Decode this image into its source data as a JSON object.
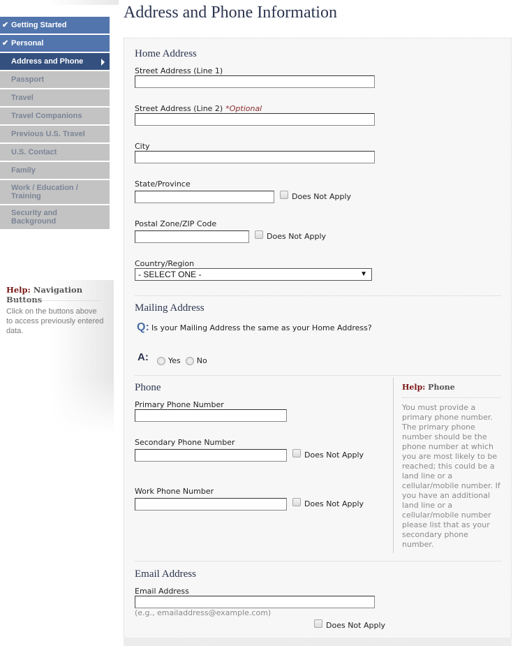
{
  "sidebar": {
    "items": [
      {
        "label": "Getting Started",
        "state": "completed",
        "icon": "check-icon"
      },
      {
        "label": "Personal",
        "state": "completed",
        "icon": "check-icon"
      },
      {
        "label": "Address and Phone",
        "state": "current",
        "icon": "arrow-right-icon"
      },
      {
        "label": "Passport",
        "state": "disabled"
      },
      {
        "label": "Travel",
        "state": "disabled"
      },
      {
        "label": "Travel Companions",
        "state": "disabled"
      },
      {
        "label": "Previous U.S. Travel",
        "state": "disabled"
      },
      {
        "label": "U.S. Contact",
        "state": "disabled"
      },
      {
        "label": "Family",
        "state": "disabled"
      },
      {
        "label": "Work / Education / Training",
        "state": "disabled"
      },
      {
        "label": "Security and Background",
        "state": "disabled"
      }
    ],
    "help": {
      "prefix": "Help:",
      "title": "Navigation Buttons",
      "text": "Click on the buttons above to access previously entered data."
    }
  },
  "page": {
    "title": "Address and Phone Information"
  },
  "home_address": {
    "title": "Home Address",
    "street1": {
      "label": "Street Address (Line 1)",
      "value": ""
    },
    "street2": {
      "label": "Street Address (Line 2)",
      "optional": "*Optional",
      "value": ""
    },
    "city": {
      "label": "City",
      "value": ""
    },
    "state": {
      "label": "State/Province",
      "value": "",
      "does_not_apply": "Does Not Apply"
    },
    "postal": {
      "label": "Postal Zone/ZIP Code",
      "value": "",
      "does_not_apply": "Does Not Apply"
    },
    "country": {
      "label": "Country/Region",
      "selected": "- SELECT ONE -"
    }
  },
  "mailing_address": {
    "title": "Mailing Address",
    "q_mark": "Q:",
    "question": "Is your Mailing Address the same as your Home Address?",
    "a_mark": "A:",
    "options": [
      "Yes",
      "No"
    ]
  },
  "phone": {
    "title": "Phone",
    "primary": {
      "label": "Primary Phone Number",
      "value": ""
    },
    "secondary": {
      "label": "Secondary Phone Number",
      "value": "",
      "does_not_apply": "Does Not Apply"
    },
    "work": {
      "label": "Work Phone Number",
      "value": "",
      "does_not_apply": "Does Not Apply"
    },
    "help": {
      "prefix": "Help:",
      "title": "Phone",
      "text": "You must provide a primary phone number. The primary phone number should be the phone number at which you are most likely to be reached; this could be a land line or a cellular/mobile number. If you have an additional land line or a cellular/mobile number please list that as your secondary phone number."
    }
  },
  "email": {
    "title": "Email Address",
    "label": "Email Address",
    "value": "",
    "hint": "(e.g., emailaddress@example.com)",
    "does_not_apply": "Does Not Apply"
  },
  "colors": {
    "nav_completed": "#5275ad",
    "nav_current": "#34507f",
    "nav_disabled": "#c3c3c3",
    "heading": "#2c3550",
    "help_accent": "#7a1414"
  }
}
